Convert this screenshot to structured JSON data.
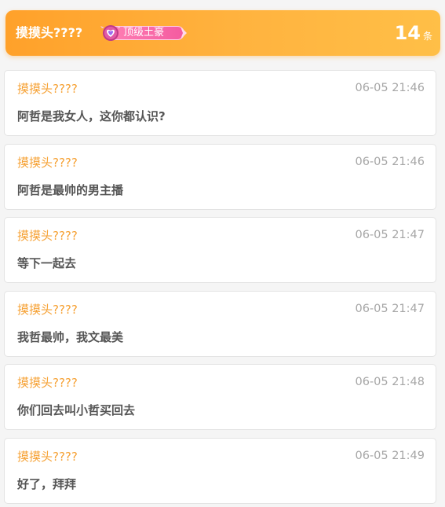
{
  "header": {
    "username": "摸摸头????",
    "rank_label": "顶级土豪",
    "count": "14",
    "count_unit": "条",
    "accent_color": "#ffa12a"
  },
  "messages": [
    {
      "name": "摸摸头????",
      "time": "06-05 21:46",
      "text": "阿哲是我女人，这你都认识?"
    },
    {
      "name": "摸摸头????",
      "time": "06-05 21:46",
      "text": "阿哲是最帅的男主播"
    },
    {
      "name": "摸摸头????",
      "time": "06-05 21:47",
      "text": "等下一起去"
    },
    {
      "name": "摸摸头????",
      "time": "06-05 21:47",
      "text": "我哲最帅，我文最美"
    },
    {
      "name": "摸摸头????",
      "time": "06-05 21:48",
      "text": "你们回去叫小哲买回去"
    },
    {
      "name": "摸摸头????",
      "time": "06-05 21:49",
      "text": "好了，拜拜"
    }
  ],
  "colors": {
    "username": "#f6a236",
    "timestamp": "#a6a6a6",
    "message_text": "#555555",
    "rank_badge": "#f45ba0"
  }
}
